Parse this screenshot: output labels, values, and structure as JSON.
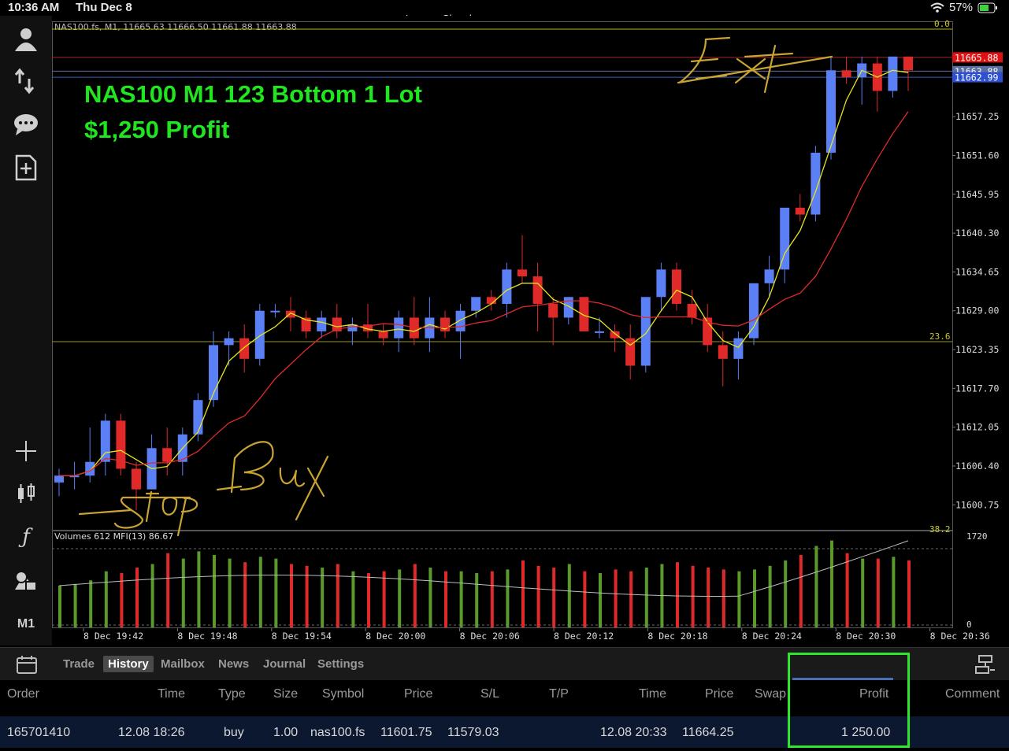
{
  "status_bar": {
    "time": "10:36 AM",
    "date": "Thu Dec 8",
    "title": "Lennox Chambers",
    "battery": "57%"
  },
  "toolbar": {
    "items": [
      {
        "name": "profile-icon"
      },
      {
        "name": "trade-icon"
      },
      {
        "name": "chat-icon"
      },
      {
        "name": "new-document-icon"
      },
      {
        "name": "crosshair-icon"
      },
      {
        "name": "chart-type-icon"
      },
      {
        "name": "indicator-icon"
      },
      {
        "name": "objects-icon"
      }
    ],
    "timeframe": "M1"
  },
  "chart": {
    "header_text": "NAS100.fs, M1, 11665.63 11666.50 11661.88 11663.88",
    "fib_top": "0.0",
    "fib_mid": "23.6",
    "fib_low": "38.2",
    "price_labels": [
      "11665.88",
      "11663.88",
      "11662.99"
    ],
    "price_ticks": [
      "11657.25",
      "11651.60",
      "11645.95",
      "11640.30",
      "11634.65",
      "11629.00",
      "11623.35",
      "11617.70",
      "11612.05",
      "11606.40",
      "11600.75"
    ],
    "time_ticks": [
      "8 Dec 19:42",
      "8 Dec 19:48",
      "8 Dec 19:54",
      "8 Dec 20:00",
      "8 Dec 20:06",
      "8 Dec 20:12",
      "8 Dec 20:18",
      "8 Dec 20:24",
      "8 Dec 20:30",
      "8 Dec 20:36"
    ],
    "volume_header": "Volumes 612 MFI(13) 86.67",
    "volume_top": "1720",
    "volume_bottom": "0",
    "handwriting": {
      "exit": "Exit",
      "buy": "Buy",
      "stop": "Stop"
    },
    "colors": {
      "bull": "#5b7ff5",
      "bear": "#e02a2a",
      "ma_fast": "#e5e51f",
      "ma_slow": "#e02a2a",
      "vol_up": "#5a9a2a",
      "vol_down": "#e02a2a"
    }
  },
  "annotation": {
    "line1": "NAS100 M1 123 Bottom 1 Lot",
    "line2": "$1,250 Profit"
  },
  "tabs": {
    "items": [
      "Trade",
      "History",
      "Mailbox",
      "News",
      "Journal",
      "Settings"
    ],
    "active": "History"
  },
  "history": {
    "headers": {
      "order": "Order",
      "time": "Time",
      "type": "Type",
      "size": "Size",
      "symbol": "Symbol",
      "price": "Price",
      "sl": "S/L",
      "tp": "T/P",
      "time2": "Time",
      "price2": "Price",
      "swap": "Swap",
      "profit": "Profit",
      "comment": "Comment"
    },
    "rows": [
      {
        "order": "165701410",
        "time": "12.08 18:26",
        "type": "buy",
        "size": "1.00",
        "symbol": "nas100.fs",
        "price": "11601.75",
        "sl": "11579.03",
        "tp": "",
        "time2": "12.08 20:33",
        "price2": "11664.25",
        "swap": "",
        "profit": "1 250.00",
        "comment": ""
      }
    ]
  },
  "chart_data": {
    "type": "candlestick",
    "candles": [
      [
        11604,
        11606,
        11602,
        11605
      ],
      [
        11605,
        11607,
        11603,
        11605
      ],
      [
        11605,
        11612,
        11604,
        11607
      ],
      [
        11607,
        11614,
        11605,
        11613
      ],
      [
        11613,
        11614,
        11605,
        11606
      ],
      [
        11606,
        11607,
        11600,
        11603
      ],
      [
        11603,
        11611,
        11603,
        11609
      ],
      [
        11609,
        11612,
        11605,
        11607
      ],
      [
        11607,
        11612,
        11605,
        11611
      ],
      [
        11611,
        11617,
        11610,
        11616
      ],
      [
        11616,
        11626,
        11615,
        11624
      ],
      [
        11624,
        11626,
        11621,
        11625
      ],
      [
        11625,
        11627,
        11620,
        11622
      ],
      [
        11622,
        11630,
        11621,
        11629
      ],
      [
        11629,
        11630,
        11628,
        11629
      ],
      [
        11629,
        11631,
        11626,
        11628
      ],
      [
        11628,
        11629,
        11625,
        11626
      ],
      [
        11626,
        11629,
        11625,
        11628
      ],
      [
        11628,
        11630,
        11625,
        11626
      ],
      [
        11626,
        11628,
        11624,
        11627
      ],
      [
        11627,
        11630,
        11625,
        11626
      ],
      [
        11626,
        11627,
        11624,
        11625
      ],
      [
        11625,
        11629,
        11623,
        11628
      ],
      [
        11628,
        11631,
        11624,
        11625
      ],
      [
        11625,
        11631,
        11623,
        11628
      ],
      [
        11628,
        11629,
        11625,
        11626
      ],
      [
        11626,
        11630,
        11622,
        11629
      ],
      [
        11629,
        11631,
        11628,
        11631
      ],
      [
        11631,
        11632,
        11629,
        11630
      ],
      [
        11630,
        11636,
        11628,
        11635
      ],
      [
        11635,
        11640,
        11633,
        11634
      ],
      [
        11634,
        11636,
        11626,
        11630
      ],
      [
        11630,
        11631,
        11624,
        11628
      ],
      [
        11628,
        11631,
        11627,
        11631
      ],
      [
        11631,
        11631,
        11626,
        11626
      ],
      [
        11626,
        11628,
        11625,
        11626
      ],
      [
        11626,
        11627,
        11623,
        11625
      ],
      [
        11625,
        11627,
        11619,
        11621
      ],
      [
        11621,
        11631,
        11620,
        11631
      ],
      [
        11631,
        11636,
        11629,
        11635
      ],
      [
        11635,
        11636,
        11629,
        11630
      ],
      [
        11630,
        11632,
        11627,
        11628
      ],
      [
        11628,
        11630,
        11623,
        11624
      ],
      [
        11624,
        11626,
        11618,
        11622
      ],
      [
        11622,
        11626,
        11619,
        11625
      ],
      [
        11625,
        11633,
        11624,
        11633
      ],
      [
        11633,
        11637,
        11631,
        11635
      ],
      [
        11635,
        11643,
        11633,
        11644
      ],
      [
        11644,
        11646,
        11642,
        11643
      ],
      [
        11643,
        11653,
        11642,
        11652
      ],
      [
        11652,
        11666,
        11651,
        11664
      ],
      [
        11664,
        11666,
        11662,
        11663
      ],
      [
        11663,
        11666,
        11659,
        11665
      ],
      [
        11665,
        11666,
        11658,
        11661
      ],
      [
        11661,
        11666,
        11660,
        11666
      ],
      [
        11666,
        11666,
        11661,
        11664
      ]
    ],
    "volumes": [
      230,
      240,
      260,
      310,
      300,
      330,
      350,
      410,
      380,
      420,
      400,
      380,
      360,
      390,
      380,
      350,
      340,
      330,
      350,
      310,
      300,
      310,
      320,
      350,
      330,
      310,
      310,
      300,
      310,
      320,
      370,
      340,
      330,
      350,
      310,
      300,
      320,
      310,
      330,
      350,
      360,
      340,
      330,
      320,
      310,
      320,
      340,
      370,
      400,
      450,
      480,
      410,
      380,
      380,
      390,
      370
    ],
    "volume_labels": [
      "1720",
      "0"
    ]
  }
}
